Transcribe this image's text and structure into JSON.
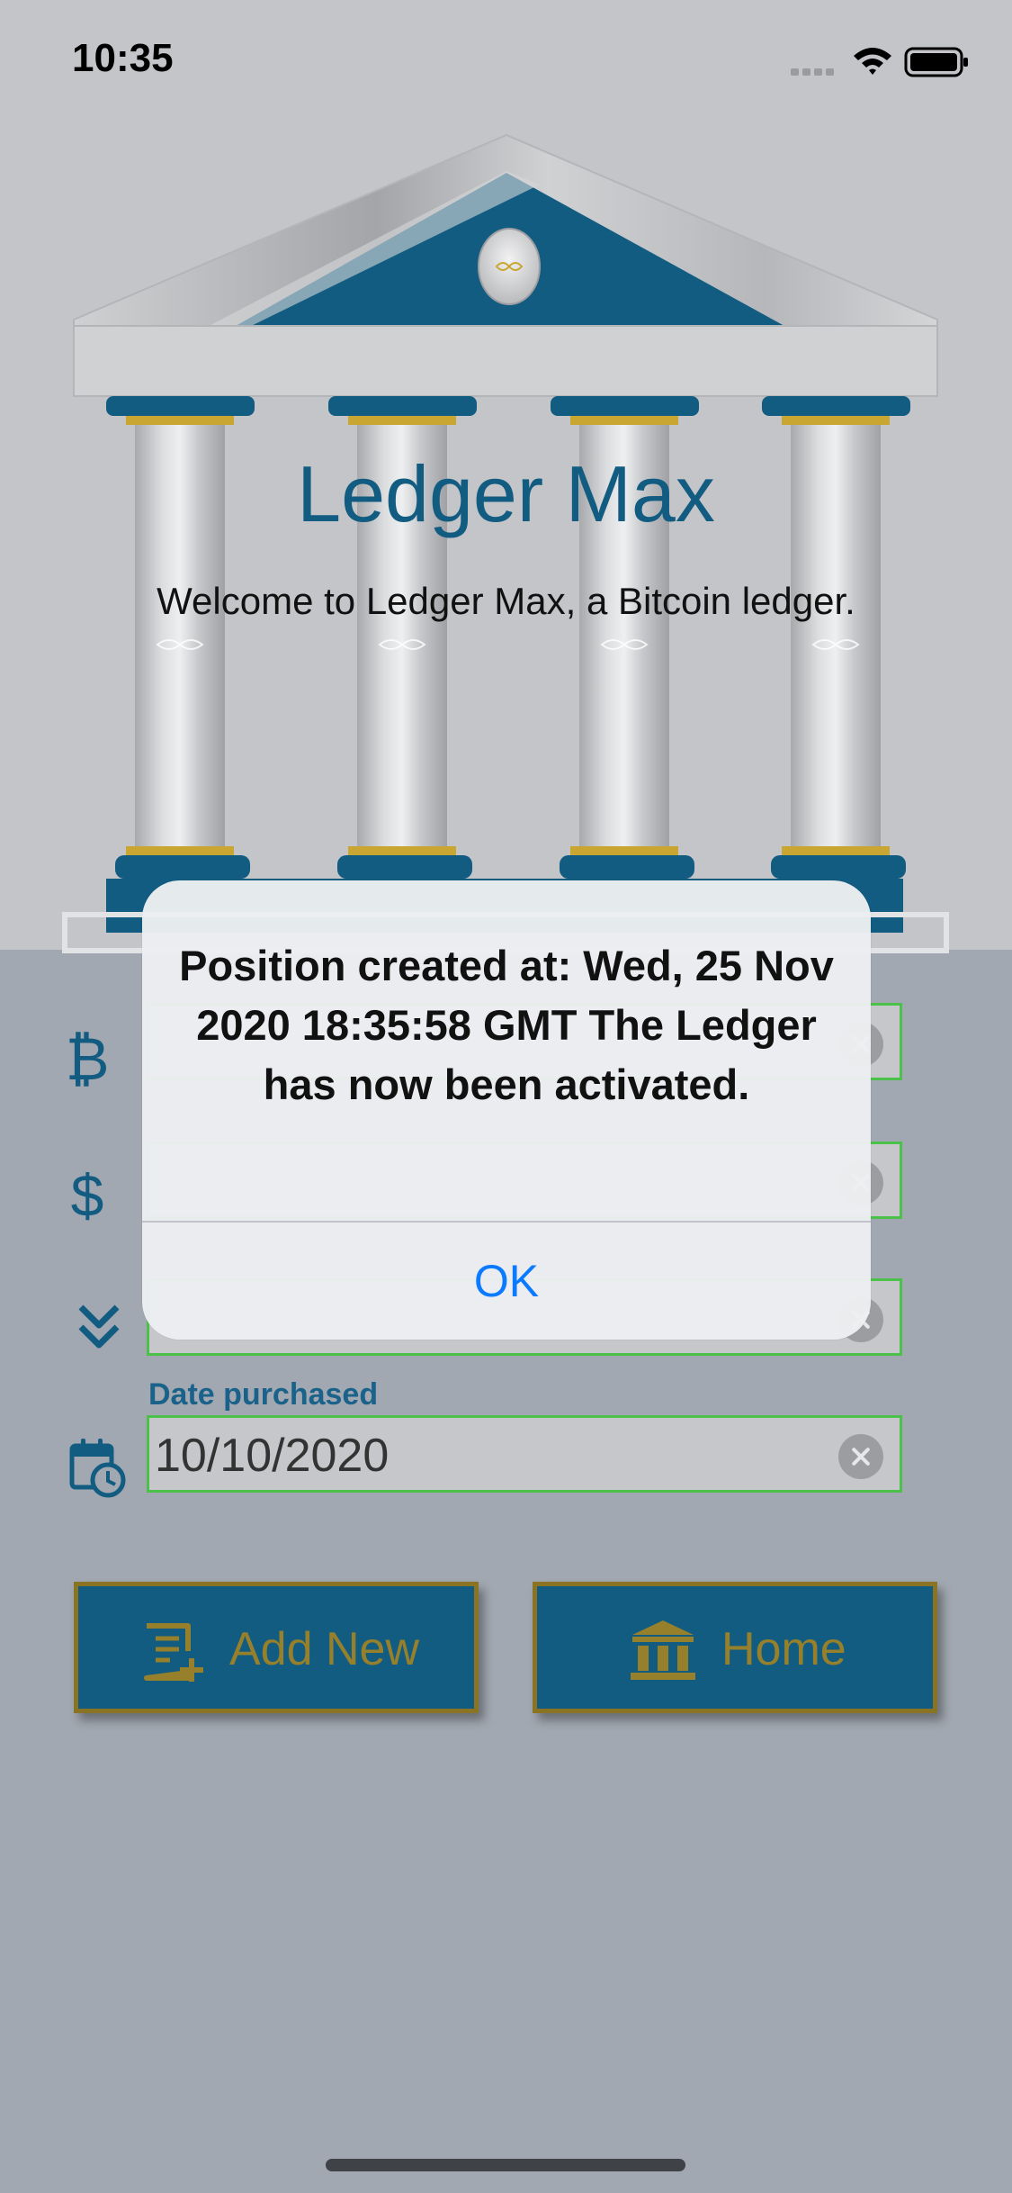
{
  "status_bar": {
    "time": "10:35"
  },
  "app": {
    "title": "Ledger Max",
    "subtitle": "Welcome to Ledger Max, a Bitcoin ledger."
  },
  "form": {
    "bitcoin_icon": "bitcoin-icon",
    "dollar_icon": "dollar-icon",
    "chevron_icon": "double-chevron-down-icon",
    "calendar_icon": "calendar-clock-icon",
    "date_label": "Date purchased",
    "date_value": "10/10/2020"
  },
  "buttons": {
    "add_new": "Add New",
    "home": "Home"
  },
  "alert": {
    "message": "Position created at: Wed, 25 Nov 2020 18:35:58 GMT The Ledger has now been activated.",
    "ok_label": "OK"
  },
  "colors": {
    "brand_blue": "#125c82",
    "gold": "#96802b",
    "field_border": "#4cc14a",
    "ios_blue": "#0a7aff"
  }
}
